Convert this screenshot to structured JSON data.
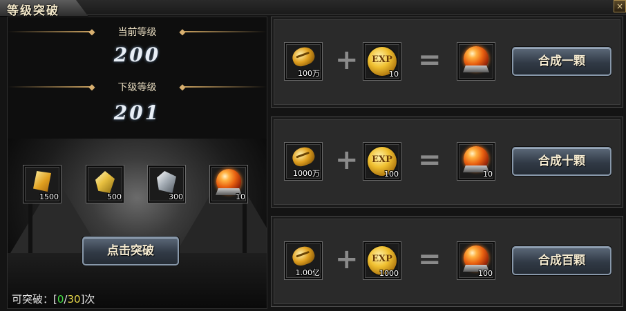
{
  "window": {
    "title": "等级突破",
    "close_label": "×"
  },
  "levels": {
    "current_label": "当前等级",
    "current_value": "200",
    "next_label": "下级等级",
    "next_value": "201"
  },
  "materials": [
    {
      "icon": "gold-scroll-icon",
      "count": "1500"
    },
    {
      "icon": "gold-crystal-icon",
      "count": "500"
    },
    {
      "icon": "silver-crystal-icon",
      "count": "300"
    },
    {
      "icon": "fire-orb-icon",
      "count": "10"
    }
  ],
  "breakthrough_button": "点击突破",
  "breakthrough_count": {
    "prefix": "可突破：[",
    "current": "0",
    "sep": "/",
    "max": "30",
    "suffix": "]次"
  },
  "recipes": [
    {
      "gold_count": "100万",
      "exp_label": "EXP",
      "exp_count": "10",
      "orb_count": "",
      "button": "合成一颗"
    },
    {
      "gold_count": "1000万",
      "exp_label": "EXP",
      "exp_count": "100",
      "orb_count": "10",
      "button": "合成十颗"
    },
    {
      "gold_count": "1.00亿",
      "exp_label": "EXP",
      "exp_count": "1000",
      "orb_count": "100",
      "button": "合成百颗"
    }
  ],
  "operators": {
    "plus": "+",
    "equals": "="
  },
  "colors": {
    "accent_gold": "#c9a160",
    "count_current": "#44dd44",
    "count_max": "#e8d84a",
    "button_blue": "#3a4554"
  }
}
